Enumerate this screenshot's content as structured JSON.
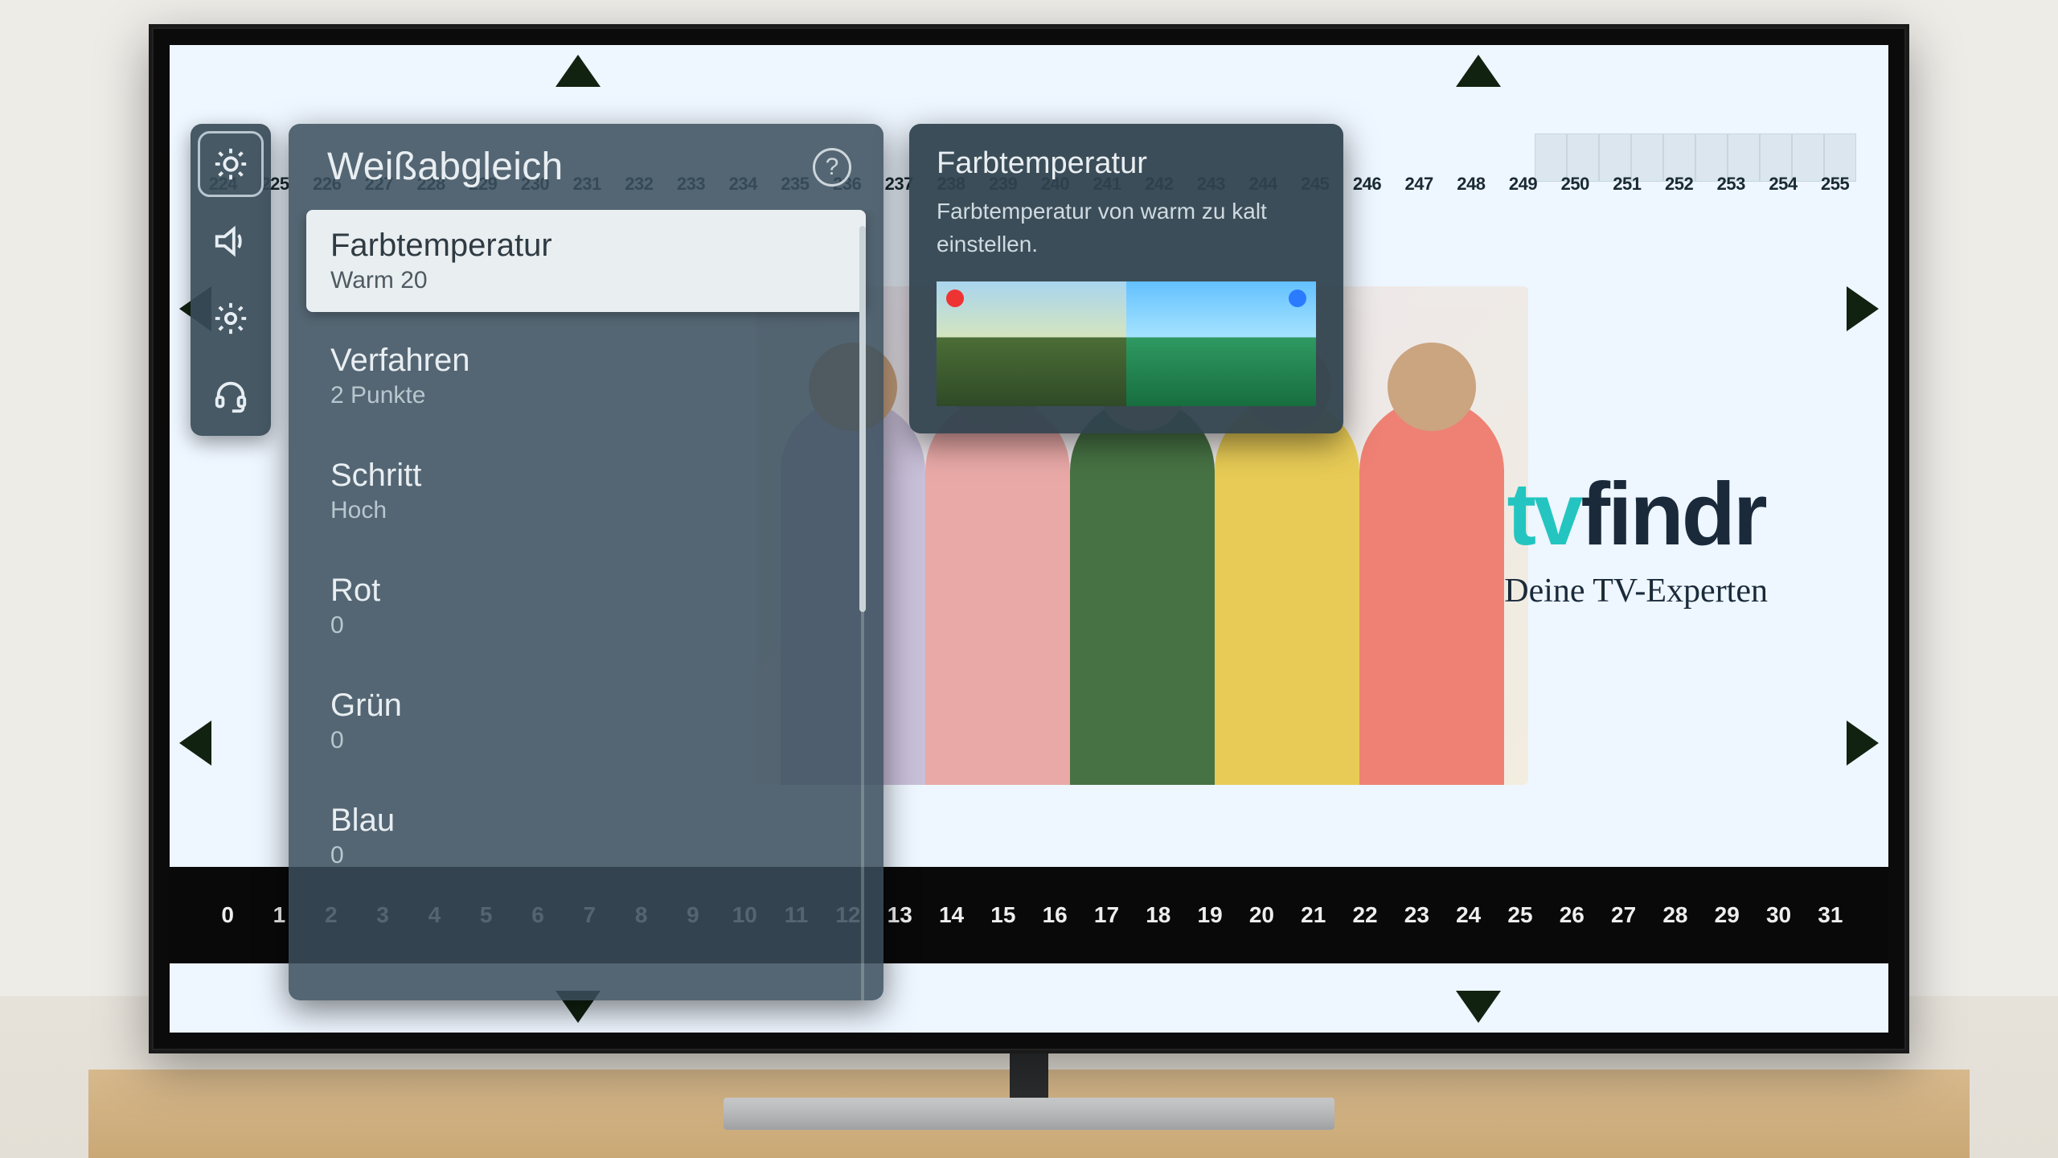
{
  "sidebar": {
    "items": [
      {
        "id": "picture",
        "icon": "brightness-icon",
        "active": true
      },
      {
        "id": "sound",
        "icon": "speaker-icon",
        "active": false
      },
      {
        "id": "settings",
        "icon": "gear-icon",
        "active": false
      },
      {
        "id": "support",
        "icon": "headset-icon",
        "active": false
      }
    ]
  },
  "panel": {
    "title": "Weißabgleich",
    "help_symbol": "?",
    "items": [
      {
        "label": "Farbtemperatur",
        "value": "Warm 20",
        "selected": true
      },
      {
        "label": "Verfahren",
        "value": "2 Punkte",
        "selected": false
      },
      {
        "label": "Schritt",
        "value": "Hoch",
        "selected": false
      },
      {
        "label": "Rot",
        "value": "0",
        "selected": false
      },
      {
        "label": "Grün",
        "value": "0",
        "selected": false
      },
      {
        "label": "Blau",
        "value": "0",
        "selected": false
      }
    ]
  },
  "tooltip": {
    "title": "Farbtemperatur",
    "text": "Farbtemperatur von warm zu kalt einstellen."
  },
  "logo": {
    "prefix": "tv",
    "suffix": "findr",
    "tagline": "Deine TV-Experten"
  },
  "top_strip": [
    "224",
    "225",
    "226",
    "227",
    "228",
    "229",
    "230",
    "231",
    "232",
    "233",
    "234",
    "235",
    "236",
    "237",
    "238",
    "239",
    "240",
    "241",
    "242",
    "243",
    "244",
    "245",
    "246",
    "247",
    "248",
    "249",
    "250",
    "251",
    "252",
    "253",
    "254",
    "255"
  ],
  "bottom_bar": [
    "0",
    "1",
    "2",
    "3",
    "4",
    "5",
    "6",
    "7",
    "8",
    "9",
    "10",
    "11",
    "12",
    "13",
    "14",
    "15",
    "16",
    "17",
    "18",
    "19",
    "20",
    "21",
    "22",
    "23",
    "24",
    "25",
    "26",
    "27",
    "28",
    "29",
    "30",
    "31"
  ]
}
